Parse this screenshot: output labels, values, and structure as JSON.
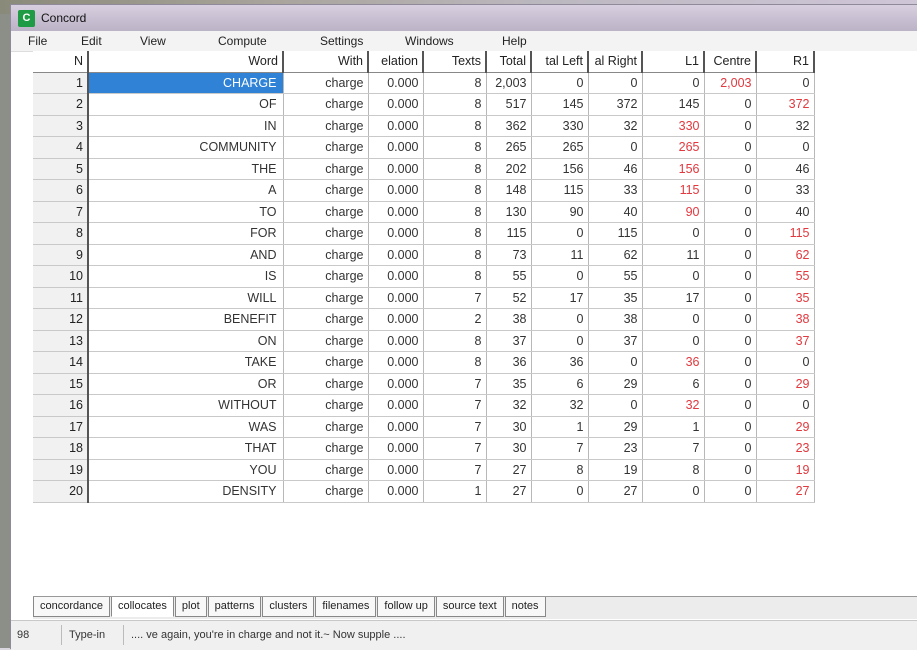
{
  "window": {
    "title": "Concord"
  },
  "menu": [
    "File",
    "Edit",
    "View",
    "Compute",
    "Settings",
    "Windows",
    "Help"
  ],
  "table": {
    "headers": [
      "N",
      "Word",
      "With",
      "elation",
      "Texts",
      "Total",
      "tal Left",
      "al Right",
      "L1",
      "Centre",
      "R1"
    ],
    "rows": [
      [
        "1",
        "CHARGE",
        "charge",
        "0.000",
        "8",
        "2,003",
        "0",
        "0",
        "0",
        "2,003",
        "0"
      ],
      [
        "2",
        "OF",
        "charge",
        "0.000",
        "8",
        "517",
        "145",
        "372",
        "145",
        "0",
        "372"
      ],
      [
        "3",
        "IN",
        "charge",
        "0.000",
        "8",
        "362",
        "330",
        "32",
        "330",
        "0",
        "32"
      ],
      [
        "4",
        "COMMUNITY",
        "charge",
        "0.000",
        "8",
        "265",
        "265",
        "0",
        "265",
        "0",
        "0"
      ],
      [
        "5",
        "THE",
        "charge",
        "0.000",
        "8",
        "202",
        "156",
        "46",
        "156",
        "0",
        "46"
      ],
      [
        "6",
        "A",
        "charge",
        "0.000",
        "8",
        "148",
        "115",
        "33",
        "115",
        "0",
        "33"
      ],
      [
        "7",
        "TO",
        "charge",
        "0.000",
        "8",
        "130",
        "90",
        "40",
        "90",
        "0",
        "40"
      ],
      [
        "8",
        "FOR",
        "charge",
        "0.000",
        "8",
        "115",
        "0",
        "115",
        "0",
        "0",
        "115"
      ],
      [
        "9",
        "AND",
        "charge",
        "0.000",
        "8",
        "73",
        "11",
        "62",
        "11",
        "0",
        "62"
      ],
      [
        "10",
        "IS",
        "charge",
        "0.000",
        "8",
        "55",
        "0",
        "55",
        "0",
        "0",
        "55"
      ],
      [
        "11",
        "WILL",
        "charge",
        "0.000",
        "7",
        "52",
        "17",
        "35",
        "17",
        "0",
        "35"
      ],
      [
        "12",
        "BENEFIT",
        "charge",
        "0.000",
        "2",
        "38",
        "0",
        "38",
        "0",
        "0",
        "38"
      ],
      [
        "13",
        "ON",
        "charge",
        "0.000",
        "8",
        "37",
        "0",
        "37",
        "0",
        "0",
        "37"
      ],
      [
        "14",
        "TAKE",
        "charge",
        "0.000",
        "8",
        "36",
        "36",
        "0",
        "36",
        "0",
        "0"
      ],
      [
        "15",
        "OR",
        "charge",
        "0.000",
        "7",
        "35",
        "6",
        "29",
        "6",
        "0",
        "29"
      ],
      [
        "16",
        "WITHOUT",
        "charge",
        "0.000",
        "7",
        "32",
        "32",
        "0",
        "32",
        "0",
        "0"
      ],
      [
        "17",
        "WAS",
        "charge",
        "0.000",
        "7",
        "30",
        "1",
        "29",
        "1",
        "0",
        "29"
      ],
      [
        "18",
        "THAT",
        "charge",
        "0.000",
        "7",
        "30",
        "7",
        "23",
        "7",
        "0",
        "23"
      ],
      [
        "19",
        "YOU",
        "charge",
        "0.000",
        "7",
        "27",
        "8",
        "19",
        "8",
        "0",
        "19"
      ],
      [
        "20",
        "DENSITY",
        "charge",
        "0.000",
        "1",
        "27",
        "0",
        "27",
        "0",
        "0",
        "27"
      ]
    ],
    "highlight_color": "#e2383e",
    "selection_color": "#2f82d6"
  },
  "tabs": [
    "concordance",
    "collocates",
    "plot",
    "patterns",
    "clusters",
    "filenames",
    "follow up",
    "source text",
    "notes"
  ],
  "active_tab": "collocates",
  "status": {
    "count": "98",
    "mode": "Type-in",
    "context": ".... ve again, you're in charge and not it.~ Now supple ...."
  }
}
